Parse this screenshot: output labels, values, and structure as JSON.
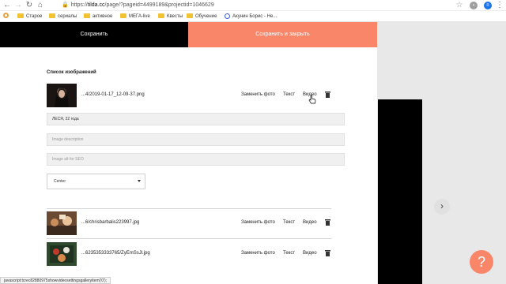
{
  "browser": {
    "url_prefix": "https://",
    "url_domain": "tilda.cc",
    "url_rest": "/page/?pageid=4499189&projectid=1046629",
    "bookmarks": [
      "Старое",
      "сериалы",
      "активное",
      "МЕГА-live",
      "Квесты",
      "Обучение",
      "Акунин Борис - Не..."
    ],
    "profile_initial": "п"
  },
  "editor": {
    "save_label": "Сохранить",
    "save_close_label": "Сохранить и закрыть",
    "list_title": "Список изображений",
    "replace_photo": "Заменить фото",
    "text_label": "Текст",
    "video_label": "Видео",
    "images": [
      {
        "file": "...4/2019-01-17_12-09-37.png"
      },
      {
        "file": "...6/chrisbarbalis223997.jpg"
      },
      {
        "file": "...6235353333765/ZyEmSsJl.jpg"
      }
    ],
    "title_value": "ЛЕСЯ, 22 года",
    "description_placeholder": "Image description",
    "alt_placeholder": "Image alt for SEO",
    "align_value": "Center"
  },
  "status_text": "javascript:tcrec82880975showvideosettingsgalleryitem('0');",
  "colors": {
    "accent": "#fa8669",
    "dark": "#000000"
  }
}
